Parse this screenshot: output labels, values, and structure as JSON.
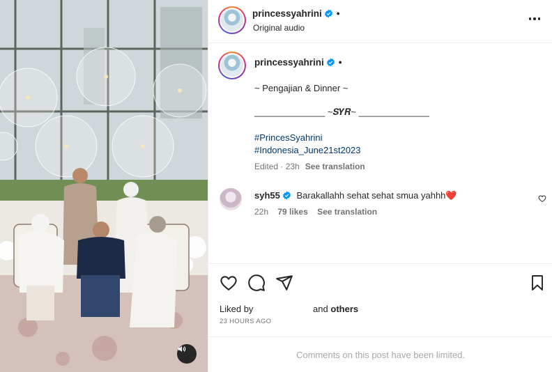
{
  "post": {
    "username": "princessyahrini",
    "audio_label": "Original audio",
    "caption_lines": [
      "~ Pengajian & Dinner ~",
      "______________ ~𝑺𝒀𝑹~ ______________"
    ],
    "hashtags": [
      "#PrincesSyahrini",
      "#Indonesia_June21st2023"
    ],
    "edited_meta": "Edited · 23h",
    "see_translation": "See translation"
  },
  "comment": {
    "username": "syh55",
    "text": "Barakallahh sehat sehat smua yahhh❤️",
    "time": "22h",
    "likes": "79 likes",
    "see_translation": "See translation"
  },
  "likes_section": {
    "liked_by_prefix": "Liked by",
    "liked_by_suffix": "and",
    "others": "others",
    "timestamp": "23 HOURS AGO"
  },
  "comments_notice": "Comments on this post have been limited.",
  "colors": {
    "verified": "#0095f6",
    "link": "#00376b",
    "muted": "#737373",
    "heart": "#ff3040"
  },
  "icons": [
    "more-icon",
    "verified-icon",
    "heart-icon",
    "comment-icon",
    "share-icon",
    "bookmark-icon",
    "sound-icon"
  ]
}
